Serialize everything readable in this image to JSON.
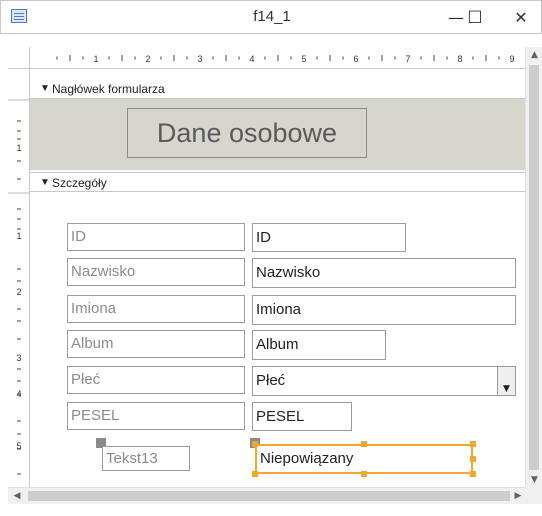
{
  "window": {
    "title": "f14_1",
    "minimize_glyph": "—",
    "maximize_glyph": "☐",
    "close_glyph": "✕"
  },
  "ruler": {
    "horizontal_numbers": [
      "1",
      "2",
      "3",
      "4",
      "5",
      "6",
      "7",
      "8",
      "9"
    ],
    "vertical_numbers": [
      "1",
      "1",
      "2",
      "3",
      "4",
      "5"
    ]
  },
  "sections": {
    "header_label": "Nagłówek formularza",
    "detail_label": "Szczegóły"
  },
  "form_title": "Dane osobowe",
  "fields": [
    {
      "label": "ID",
      "control": "ID"
    },
    {
      "label": "Nazwisko",
      "control": "Nazwisko"
    },
    {
      "label": "Imiona",
      "control": "Imiona"
    },
    {
      "label": "Album",
      "control": "Album"
    },
    {
      "label": "Płeć",
      "control": "Płeć"
    },
    {
      "label": "PESEL",
      "control": "PESEL"
    }
  ],
  "unbound": {
    "label": "Tekst13",
    "control": "Niepowiązany"
  },
  "colors": {
    "header_background": "#d7d6cd",
    "selection": "#f0a830"
  },
  "icons": {
    "section_arrow": "▼",
    "combo_arrow": "▼",
    "scroll_up": "▲",
    "scroll_down": "▼",
    "scroll_left": "◀",
    "scroll_right": "▶"
  }
}
